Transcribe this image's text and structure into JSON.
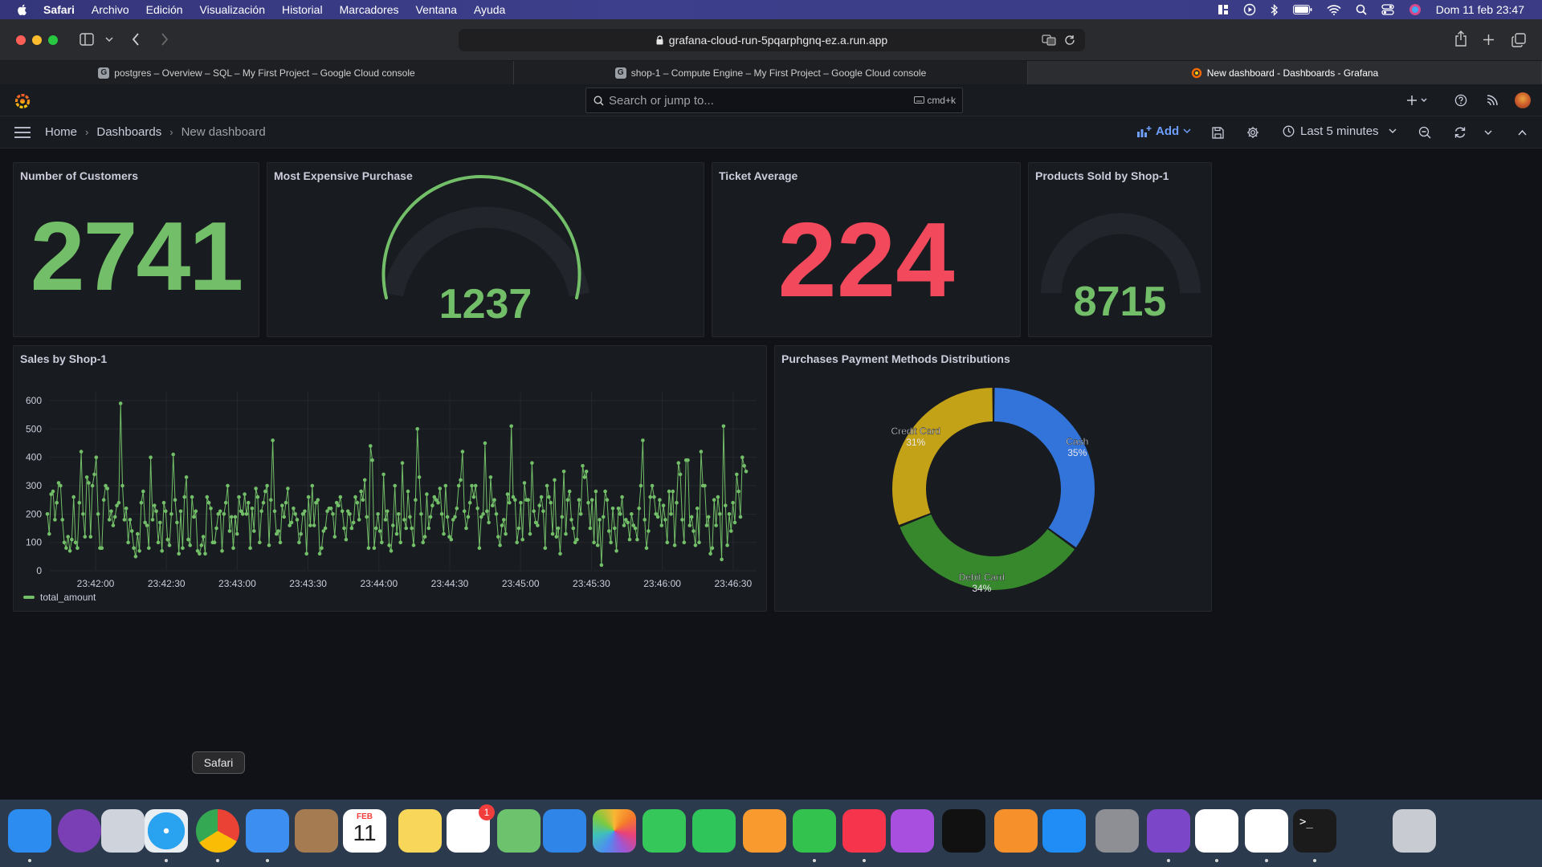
{
  "menubar": {
    "app": "Safari",
    "items": [
      "Archivo",
      "Edición",
      "Visualización",
      "Historial",
      "Marcadores",
      "Ventana",
      "Ayuda"
    ],
    "datetime": "Dom 11 feb 23:47"
  },
  "browser": {
    "url": "grafana-cloud-run-5pqarphgnq-ez.a.run.app",
    "tabs": [
      {
        "label": "postgres – Overview – SQL – My First Project – Google Cloud console",
        "active": false
      },
      {
        "label": "shop-1 – Compute Engine – My First Project – Google Cloud console",
        "active": false
      },
      {
        "label": "New dashboard - Dashboards - Grafana",
        "active": true
      }
    ]
  },
  "grafana": {
    "search_placeholder": "Search or jump to...",
    "search_shortcut": "cmd+k",
    "breadcrumbs": [
      "Home",
      "Dashboards",
      "New dashboard"
    ],
    "add_label": "Add",
    "time_range": "Last 5 minutes"
  },
  "panels": {
    "customers": {
      "title": "Number of Customers",
      "value": "2741",
      "color": "#73bf69"
    },
    "expensive": {
      "title": "Most Expensive Purchase",
      "value": "1237",
      "color": "#73bf69",
      "gauge_fraction": 1.0
    },
    "ticket": {
      "title": "Ticket Average",
      "value": "224",
      "color": "#f2495c"
    },
    "products": {
      "title": "Products Sold by Shop-1",
      "value": "8715",
      "color": "#73bf69",
      "gauge_fraction": 0.0
    },
    "sales": {
      "title": "Sales by Shop-1",
      "legend": "total_amount"
    },
    "payments": {
      "title": "Purchases Payment Methods Distributions"
    }
  },
  "chart_data": [
    {
      "type": "line",
      "title": "Sales by Shop-1",
      "xlabel": "",
      "ylabel": "",
      "ylim": [
        0,
        600
      ],
      "yticks": [
        "0",
        "100",
        "200",
        "300",
        "400",
        "500",
        "600"
      ],
      "xticks": [
        "23:42:00",
        "23:42:30",
        "23:43:00",
        "23:43:30",
        "23:44:00",
        "23:44:30",
        "23:45:00",
        "23:45:30",
        "23:46:00",
        "23:46:30"
      ],
      "grid": true,
      "legend": "bottom-left",
      "series": [
        {
          "name": "total_amount",
          "color": "#73bf69",
          "values": [
            200,
            130,
            270,
            280,
            180,
            240,
            310,
            300,
            180,
            100,
            80,
            120,
            70,
            110,
            260,
            100,
            80,
            240,
            420,
            200,
            120,
            330,
            310,
            120,
            300,
            340,
            400,
            200,
            80,
            80,
            250,
            300,
            290,
            180,
            210,
            160,
            190,
            230,
            240,
            590,
            300,
            180,
            220,
            100,
            180,
            140,
            80,
            50,
            130,
            70,
            240,
            280,
            170,
            160,
            80,
            400,
            180,
            230,
            210,
            100,
            170,
            70,
            240,
            210,
            110,
            90,
            200,
            410,
            250,
            170,
            60,
            210,
            80,
            260,
            330,
            110,
            90,
            260,
            190,
            210,
            70,
            60,
            90,
            120,
            60,
            260,
            240,
            220,
            100,
            100,
            150,
            200,
            210,
            70,
            200,
            240,
            300,
            140,
            190,
            80,
            190,
            130,
            260,
            210,
            200,
            270,
            200,
            240,
            80,
            220,
            140,
            290,
            260,
            100,
            210,
            240,
            280,
            300,
            90,
            250,
            460,
            210,
            130,
            140,
            100,
            230,
            190,
            240,
            290,
            160,
            170,
            220,
            200,
            180,
            100,
            130,
            200,
            210,
            60,
            260,
            160,
            300,
            160,
            240,
            250,
            60,
            80,
            140,
            150,
            210,
            220,
            220,
            200,
            120,
            240,
            230,
            260,
            210,
            150,
            110,
            210,
            200,
            150,
            170,
            260,
            240,
            180,
            280,
            250,
            320,
            190,
            80,
            440,
            390,
            80,
            150,
            200,
            140,
            100,
            340,
            180,
            210,
            90,
            70,
            160,
            300,
            130,
            200,
            100,
            380,
            180,
            150,
            280,
            190,
            150,
            90,
            250,
            500,
            330,
            200,
            100,
            120,
            270,
            150,
            190,
            230,
            260,
            250,
            240,
            290,
            200,
            130,
            300,
            190,
            120,
            110,
            180,
            190,
            220,
            300,
            320,
            420,
            210,
            150,
            190,
            240,
            300,
            260,
            300,
            220,
            80,
            190,
            200,
            450,
            210,
            170,
            330,
            230,
            250,
            200,
            120,
            90,
            160,
            180,
            130,
            270,
            240,
            510,
            260,
            250,
            100,
            150,
            240,
            110,
            310,
            250,
            250,
            130,
            380,
            210,
            170,
            160,
            230,
            260,
            210,
            80,
            300,
            260,
            240,
            130,
            320,
            120,
            150,
            60,
            190,
            350,
            130,
            250,
            280,
            180,
            150,
            100,
            110,
            250,
            200,
            370,
            330,
            350,
            240,
            150,
            250,
            100,
            280,
            90,
            180,
            20,
            190,
            280,
            250,
            140,
            100,
            220,
            150,
            70,
            220,
            200,
            260,
            160,
            180,
            170,
            110,
            200,
            160,
            150,
            110,
            220,
            300,
            460,
            180,
            80,
            140,
            260,
            300,
            260,
            200,
            190,
            250,
            160,
            230,
            180,
            100,
            280,
            200,
            280,
            90,
            240,
            380,
            340,
            180,
            100,
            390,
            390,
            160,
            190,
            140,
            90,
            220,
            100,
            420,
            300,
            300,
            160,
            190,
            60,
            80,
            250,
            160,
            260,
            200,
            40,
            510,
            230,
            90,
            200,
            140,
            240,
            170,
            340,
            280,
            190,
            400,
            370,
            350
          ]
        }
      ]
    },
    {
      "type": "pie",
      "title": "Purchases Payment Methods Distributions",
      "slices": [
        {
          "label": "Cash",
          "value": 35,
          "pct": "35%",
          "color": "#3274d9"
        },
        {
          "label": "Debit Card",
          "value": 34,
          "pct": "34%",
          "color": "#37872d"
        },
        {
          "label": "Credit Card",
          "value": 31,
          "pct": "31%",
          "color": "#c4a218"
        }
      ]
    }
  ],
  "dock": {
    "tooltip": "Safari",
    "calendar_month": "FEB",
    "calendar_day": "11",
    "reminders_badge": "1",
    "apps": [
      {
        "name": "finder-icon",
        "color": "#2d8cf0"
      },
      {
        "name": "siri-icon",
        "color": "#7a3fb5"
      },
      {
        "name": "launchpad-icon",
        "color": "#cfd3dc"
      },
      {
        "name": "safari-icon",
        "color": "#1e88e5"
      },
      {
        "name": "chrome-icon",
        "color": "#ffffff"
      },
      {
        "name": "mail-icon",
        "color": "#3c8ef0"
      },
      {
        "name": "contacts-icon",
        "color": "#a57c52"
      },
      {
        "name": "calendar-icon",
        "color": "#ffffff"
      },
      {
        "name": "notes-icon",
        "color": "#f8d65a"
      },
      {
        "name": "reminders-icon",
        "color": "#ffffff"
      },
      {
        "name": "maps-icon",
        "color": "#6cc26d"
      },
      {
        "name": "keynote-icon",
        "color": "#2f86e8"
      },
      {
        "name": "photos-icon",
        "color": "#ffffff"
      },
      {
        "name": "messages-icon",
        "color": "#35c759"
      },
      {
        "name": "facetime-icon",
        "color": "#2fc55a"
      },
      {
        "name": "pages-icon",
        "color": "#f99a2f"
      },
      {
        "name": "numbers-icon",
        "color": "#34c24f"
      },
      {
        "name": "music-icon",
        "color": "#f6344c"
      },
      {
        "name": "podcasts-icon",
        "color": "#a84fe0"
      },
      {
        "name": "appletv-icon",
        "color": "#111111"
      },
      {
        "name": "books-icon",
        "color": "#f6902a"
      },
      {
        "name": "appstore-icon",
        "color": "#1f8df5"
      },
      {
        "name": "system-settings-icon",
        "color": "#8d8f95"
      },
      {
        "name": "github-desktop-icon",
        "color": "#7b46c7"
      },
      {
        "name": "vscode-icon",
        "color": "#ffffff"
      },
      {
        "name": "pgadmin-icon",
        "color": "#ffffff"
      },
      {
        "name": "terminal-icon",
        "color": "#1b1b1b"
      },
      {
        "name": "trash-icon",
        "color": "#c8ccd2"
      }
    ]
  }
}
